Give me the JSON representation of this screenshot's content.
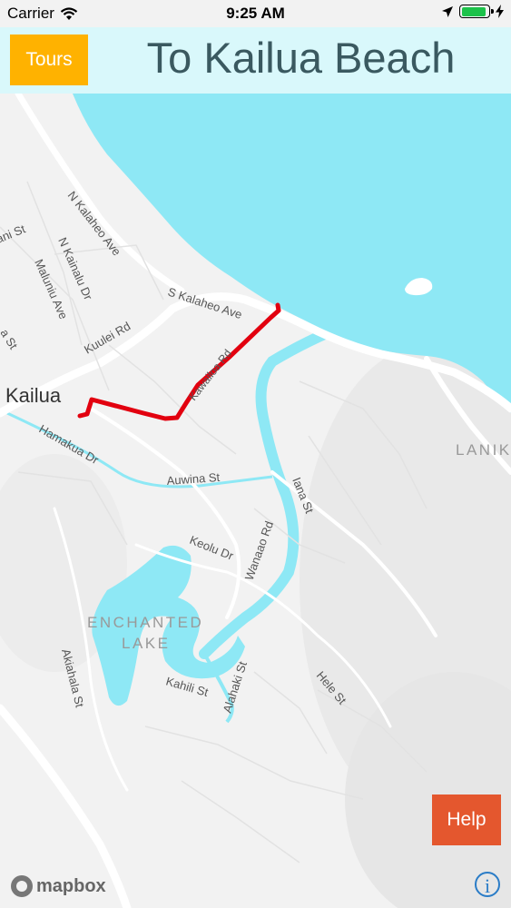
{
  "status_bar": {
    "carrier": "Carrier",
    "time": "9:25 AM",
    "battery_fill_fraction": 0.9
  },
  "header": {
    "tours_label": "Tours",
    "title": "To Kailua Beach"
  },
  "map": {
    "labels": {
      "kailua": "Kailua",
      "n_kalaheo": "N Kalaheo Ave",
      "n_kainalu": "N Kainalu Dr",
      "maluniu": "Maluniu Ave",
      "ani": "ani St",
      "a_st": "a St",
      "kuulei": "Kuulei Rd",
      "s_kalaheo": "S Kalaheo Ave",
      "kawailoa": "Kawailoa Rd",
      "hamakua": "Hamakua Dr",
      "auwina": "Auwina St",
      "iana": "Iana St",
      "keolu": "Keolu Dr",
      "wanaao": "Wanaao Rd",
      "enchanted": "ENCHANTED",
      "lake": "LAKE",
      "akiahala": "Akiahala St",
      "kahili": "Kahili St",
      "alahaki": "Alahaki St",
      "hele": "Hele St",
      "lanik": "LANIK"
    },
    "logo_text": "mapbox"
  },
  "help_label": "Help",
  "info_symbol": "i",
  "colors": {
    "header_bg": "#d9f8fb",
    "tours": "#ffb200",
    "help": "#e4572e",
    "water": "#8ee8f5",
    "route": "#e2000f"
  }
}
